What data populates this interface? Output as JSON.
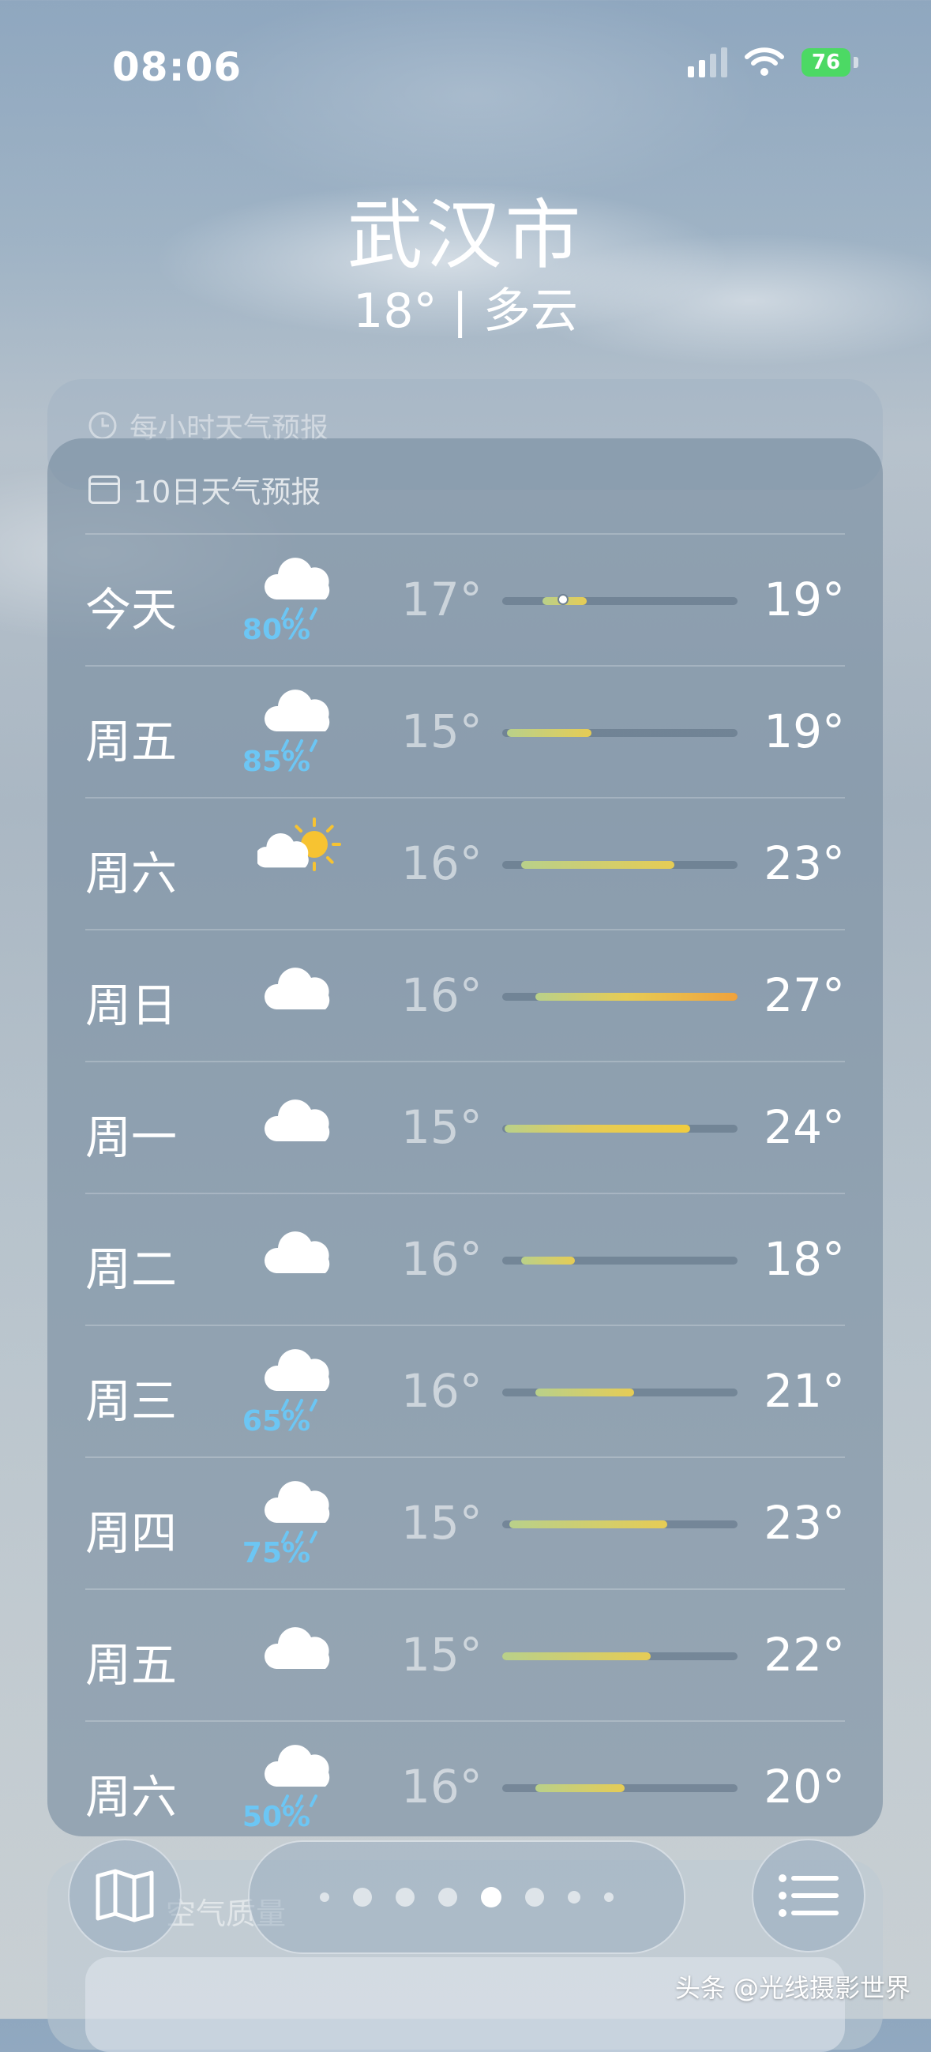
{
  "status_bar": {
    "time": "08:06",
    "battery": "76",
    "icons": [
      "cellular-signal-icon",
      "wifi-icon",
      "battery-charging-icon"
    ]
  },
  "header": {
    "city": "武汉市",
    "summary": "18° | 多云"
  },
  "hourly_card": {
    "title": "每小时天气预报",
    "icon": "clock-icon"
  },
  "forecast": {
    "title": "10日天气预报",
    "icon": "calendar-icon",
    "days": [
      {
        "day": "今天",
        "icon": "cloud-rain-icon",
        "precip": "80%",
        "low": "17°",
        "high": "19°"
      },
      {
        "day": "周五",
        "icon": "cloud-rain-icon",
        "precip": "85%",
        "low": "15°",
        "high": "19°"
      },
      {
        "day": "周六",
        "icon": "partly-sunny-icon",
        "precip": "",
        "low": "16°",
        "high": "23°"
      },
      {
        "day": "周日",
        "icon": "cloud-icon",
        "precip": "",
        "low": "16°",
        "high": "27°"
      },
      {
        "day": "周一",
        "icon": "cloud-icon",
        "precip": "",
        "low": "15°",
        "high": "24°"
      },
      {
        "day": "周二",
        "icon": "cloud-icon",
        "precip": "",
        "low": "16°",
        "high": "18°"
      },
      {
        "day": "周三",
        "icon": "cloud-rain-icon",
        "precip": "65%",
        "low": "16°",
        "high": "21°"
      },
      {
        "day": "周四",
        "icon": "cloud-rain-icon",
        "precip": "75%",
        "low": "15°",
        "high": "23°"
      },
      {
        "day": "周五",
        "icon": "cloud-icon",
        "precip": "",
        "low": "15°",
        "high": "22°"
      },
      {
        "day": "周六",
        "icon": "cloud-rain-icon",
        "precip": "50%",
        "low": "16°",
        "high": "20°"
      }
    ],
    "ranges": [
      {
        "from": 0.17,
        "to": 0.36,
        "current": 0.26
      },
      {
        "from": 0.02,
        "to": 0.38
      },
      {
        "from": 0.08,
        "to": 0.73
      },
      {
        "from": 0.14,
        "to": 1.0,
        "color_end": "#f0a23c"
      },
      {
        "from": 0.01,
        "to": 0.8,
        "color_end": "#f0cc3e"
      },
      {
        "from": 0.08,
        "to": 0.31
      },
      {
        "from": 0.14,
        "to": 0.56
      },
      {
        "from": 0.03,
        "to": 0.7
      },
      {
        "from": 0.0,
        "to": 0.63
      },
      {
        "from": 0.14,
        "to": 0.52
      }
    ]
  },
  "bottom": {
    "aq_label": "空气质量",
    "map_icon": "map-icon",
    "list_icon": "list-icon",
    "page_count": 8,
    "active_page": 5
  },
  "watermark": "头条 @光线摄影世界",
  "colors": {
    "precip": "#6cc6f4",
    "battery": "#4cd964"
  }
}
